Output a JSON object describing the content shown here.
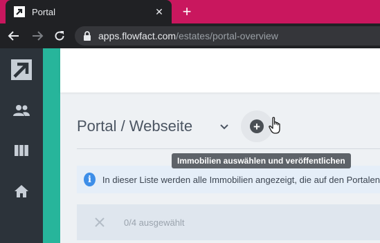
{
  "browser": {
    "tab_title": "Portal",
    "new_tab_label": "+",
    "url_host": "apps.flowfact.com",
    "url_path": "/estates/portal-overview"
  },
  "colors": {
    "tabstrip": "#c9175e",
    "sidebar": "#2c333a",
    "accent": "#27b59b",
    "info": "#3d8ee8"
  },
  "sidebar": {
    "items": [
      {
        "icon": "logo-arrow-icon"
      },
      {
        "icon": "people-icon"
      },
      {
        "icon": "columns-icon"
      },
      {
        "icon": "home-icon"
      }
    ]
  },
  "main": {
    "title": "Portal / Webseite",
    "tooltip": "Immobilien auswählen und veröffentlichen",
    "info_text": "In dieser Liste werden alle Immobilien angezeigt, die auf den Portalen",
    "selection_count": "0/4 ausgewählt"
  }
}
